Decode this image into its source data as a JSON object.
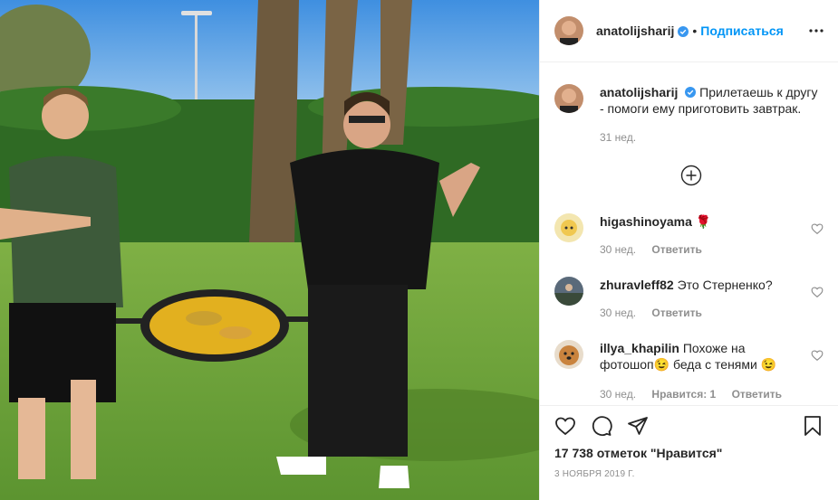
{
  "post": {
    "author": "anatolijsharij",
    "follow_label": "Подписаться",
    "dot": "•",
    "caption": "Прилетаешь к другу - помоги ему приготовить завтрак.",
    "caption_time": "31 нед."
  },
  "comments": [
    {
      "user": "higashinoyama",
      "text": "🌹",
      "time": "30 нед.",
      "reply": "Ответить",
      "likes": ""
    },
    {
      "user": "zhuravleff82",
      "text": "Это Стерненко?",
      "time": "30 нед.",
      "reply": "Ответить",
      "likes": ""
    },
    {
      "user": "illya_khapilin",
      "text": "Похоже на фотошоп😉 беда с тенями 😉",
      "time": "30 нед.",
      "reply": "Ответить",
      "likes": "Нравится: 1"
    }
  ],
  "footer": {
    "likes": "17 738 отметок \"Нравится\"",
    "date": "3 НОЯБРЯ 2019 Г."
  },
  "icons": [
    "verified-icon",
    "more-icon",
    "plus-circle-icon",
    "heart-icon",
    "comment-icon",
    "share-icon",
    "bookmark-icon"
  ],
  "colors": {
    "accent": "#0095f6",
    "muted": "#8e8e8e",
    "text": "#262626",
    "border": "#efefef"
  }
}
